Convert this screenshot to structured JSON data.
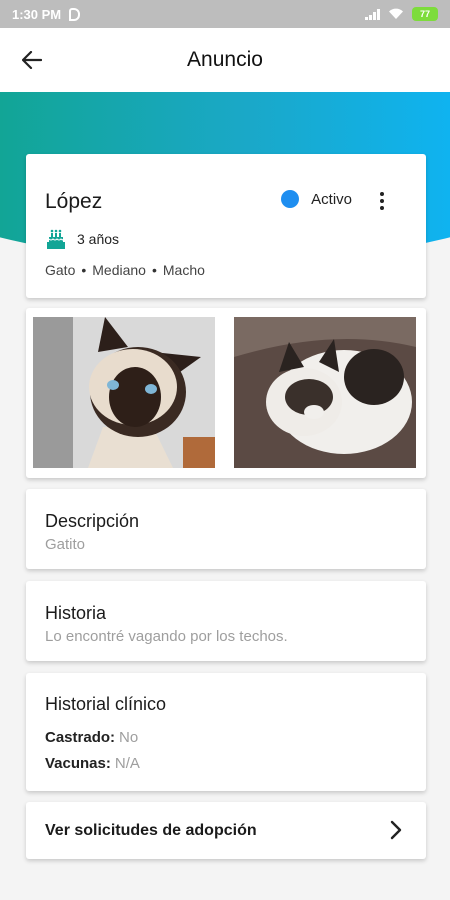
{
  "status_bar": {
    "time": "1:30 PM",
    "battery": "77"
  },
  "app_bar": {
    "title": "Anuncio"
  },
  "pet": {
    "name": "López",
    "status": "Activo",
    "status_color": "#1e8ef0",
    "age": "3 años",
    "traits": [
      "Gato",
      "Mediano",
      "Macho"
    ]
  },
  "description": {
    "heading": "Descripción",
    "value": "Gatito"
  },
  "history": {
    "heading": "Historia",
    "value": "Lo encontré vagando por los techos."
  },
  "clinical": {
    "heading": "Historial clínico",
    "castrado_label": "Castrado:",
    "castrado_value": "No",
    "vacunas_label": "Vacunas:",
    "vacunas_value": "N/A"
  },
  "actions": {
    "view_requests": "Ver solicitudes de adopción"
  },
  "theme": {
    "accent_teal": "#12a596",
    "accent_blue": "#0fb3f0"
  }
}
